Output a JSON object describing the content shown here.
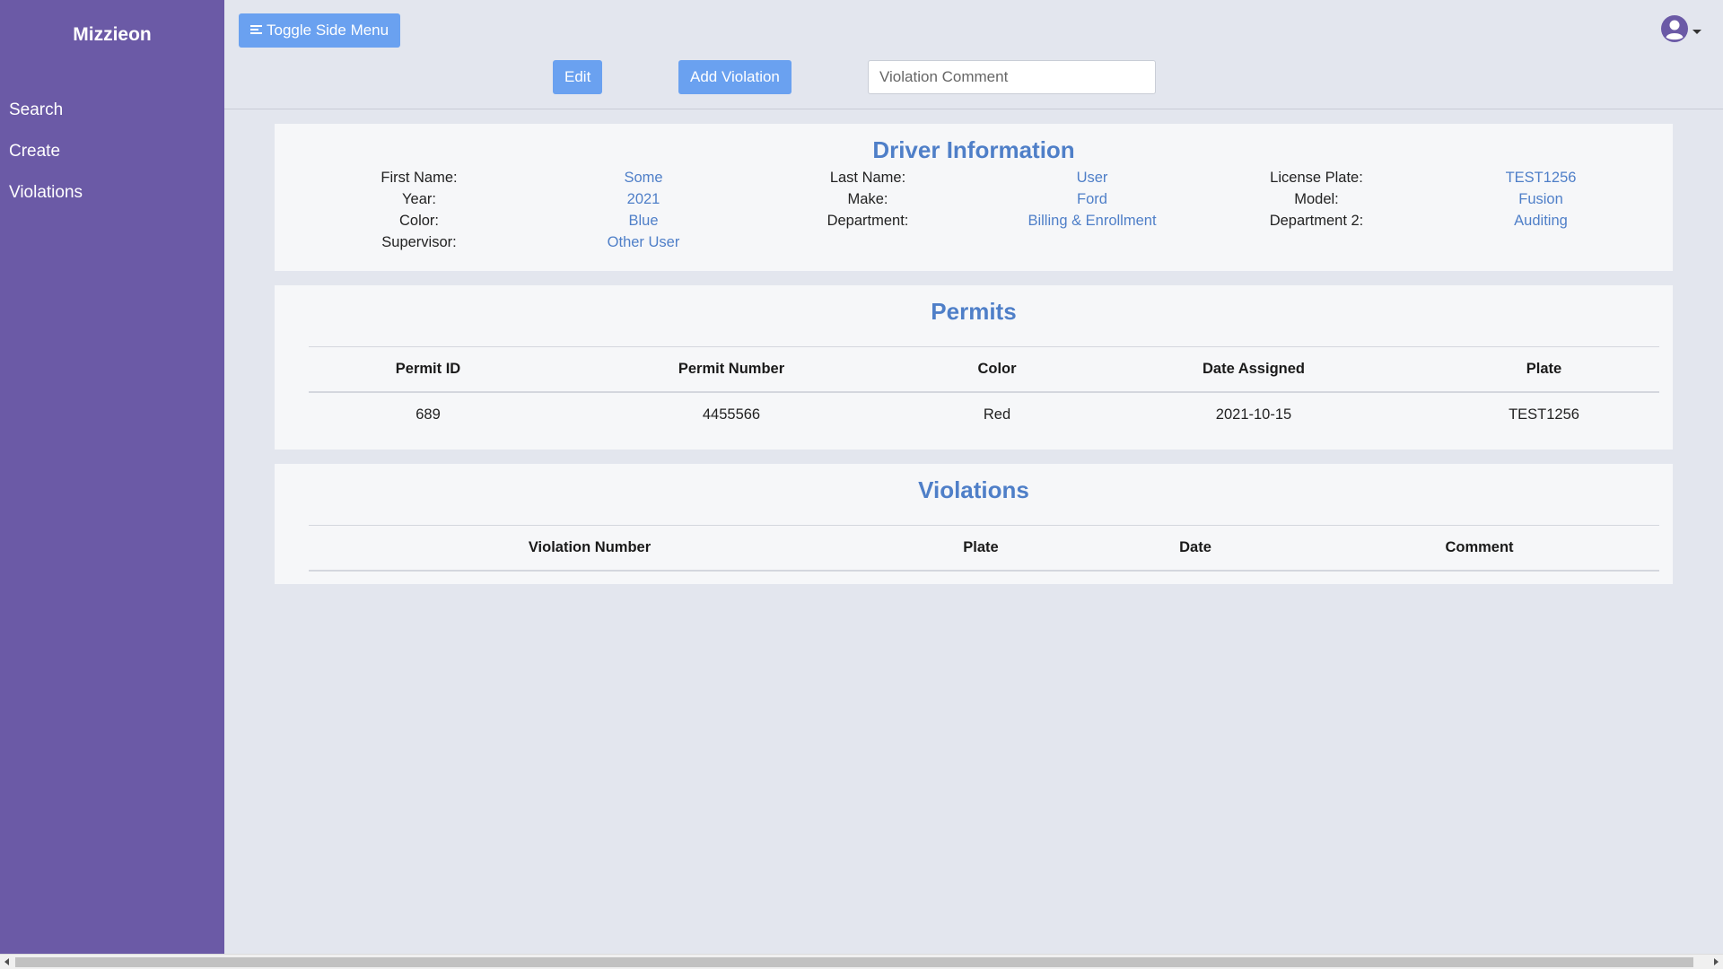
{
  "sidebar": {
    "brand": "Mizzieon",
    "items": [
      {
        "label": "Search"
      },
      {
        "label": "Create"
      },
      {
        "label": "Violations"
      }
    ],
    "background": "#6b5aa6"
  },
  "toolbar": {
    "toggle_label": "Toggle Side Menu",
    "edit_label": "Edit",
    "add_violation_label": "Add Violation",
    "comment_placeholder": "Violation Comment",
    "accent": "#6aa1f0",
    "user_icon": "user-circle-icon"
  },
  "driver": {
    "title": "Driver Information",
    "rows": [
      [
        {
          "label": "First Name:",
          "value": "Some"
        },
        {
          "label": "Last Name:",
          "value": "User"
        },
        {
          "label": "License Plate:",
          "value": "TEST1256"
        }
      ],
      [
        {
          "label": "Year:",
          "value": "2021"
        },
        {
          "label": "Make:",
          "value": "Ford"
        },
        {
          "label": "Model:",
          "value": "Fusion"
        }
      ],
      [
        {
          "label": "Color:",
          "value": "Blue"
        },
        {
          "label": "Department:",
          "value": "Billing & Enrollment"
        },
        {
          "label": "Department 2:",
          "value": "Auditing"
        }
      ],
      [
        {
          "label": "Supervisor:",
          "value": "Other User"
        }
      ]
    ]
  },
  "permits": {
    "title": "Permits",
    "columns": [
      "Permit ID",
      "Permit Number",
      "Color",
      "Date Assigned",
      "Plate"
    ],
    "rows": [
      [
        "689",
        "4455566",
        "Red",
        "2021-10-15",
        "TEST1256"
      ]
    ]
  },
  "violations": {
    "title": "Violations",
    "columns": [
      "Violation Number",
      "Plate",
      "Date",
      "Comment"
    ],
    "rows": []
  }
}
